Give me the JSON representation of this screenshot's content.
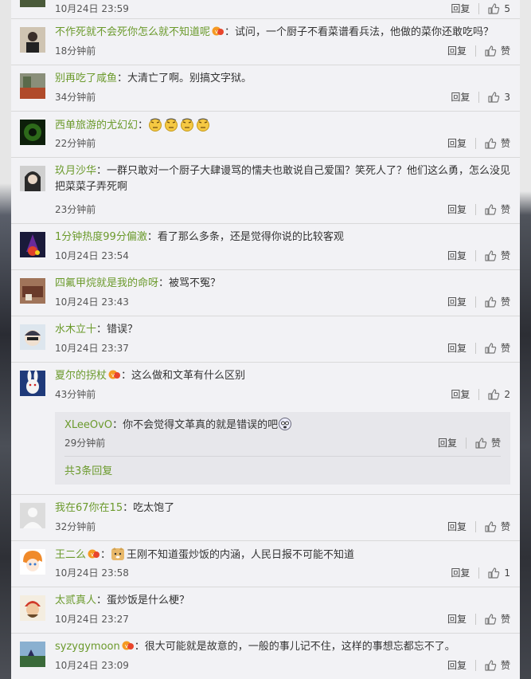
{
  "reply_label": "回复",
  "like_label": "赞",
  "comments": [
    {
      "time": "10月24日 23:59",
      "likes": "5"
    },
    {
      "user": "不作死就不会死你怎么就不知道呢",
      "text": "：试问，一个厨子不看菜谱看兵法，他做的菜你还敢吃吗？",
      "time": "18分钟前",
      "likes": "赞"
    },
    {
      "user": "别再吃了咸鱼",
      "text": "：大清亡了啊。别搞文字狱。",
      "time": "34分钟前",
      "likes": "3"
    },
    {
      "user": "西单旅游的尤幻幻",
      "text": "：",
      "time": "22分钟前",
      "likes": "赞"
    },
    {
      "user": "玖月沙华",
      "text": "：一群只敢对一个厨子大肆谩骂的懦夫也敢说自己爱国？笑死人了？他们这么勇，怎么没见把菜菜子弄死啊",
      "time": "23分钟前",
      "likes": "赞"
    },
    {
      "user": "1分钟热度99分偏激",
      "text": "：看了那么多条，还是觉得你说的比较客观",
      "time": "10月24日 23:54",
      "likes": "赞"
    },
    {
      "user": "四氟甲烷就是我的命呀",
      "text": "：被骂不冤？",
      "time": "10月24日 23:43",
      "likes": "赞"
    },
    {
      "user": "水木立十",
      "text": "：错误？",
      "time": "10月24日 23:37",
      "likes": "赞"
    },
    {
      "user": "夏尔的拐杖",
      "text": "：这么做和文革有什么区别",
      "time": "43分钟前",
      "likes": "2"
    },
    {
      "user": "我在67你在15",
      "text": "：吃太饱了",
      "time": "32分钟前",
      "likes": "赞"
    },
    {
      "user": "王二么",
      "text": "王刚不知道蛋炒饭的内涵，人民日报不可能不知道",
      "time": "10月24日 23:58",
      "likes": "1"
    },
    {
      "user": "太贰真人",
      "text": "：蛋炒饭是什么梗？",
      "time": "10月24日 23:27",
      "likes": "赞"
    },
    {
      "user": "syzygymoon",
      "text": "：很大可能就是故意的，一般的事儿记不住，这样的事想忘都忘不了。",
      "time": "10月24日 23:09",
      "likes": "赞"
    }
  ],
  "sub_reply": {
    "user": "XLeeOvO",
    "text": "：你不会觉得文革真的就是错误的吧",
    "time": "29分钟前",
    "likes": "赞"
  },
  "more_replies_label": "共3条回复",
  "colors": {
    "username": "#6b9a2c",
    "panel_bg": "#f2f2f5",
    "sub_bg": "#e7e7eb",
    "divider": "#d9d9d9"
  },
  "icons": [
    "thumbs-up-icon",
    "vip-badge-icon",
    "emoji-icon"
  ]
}
